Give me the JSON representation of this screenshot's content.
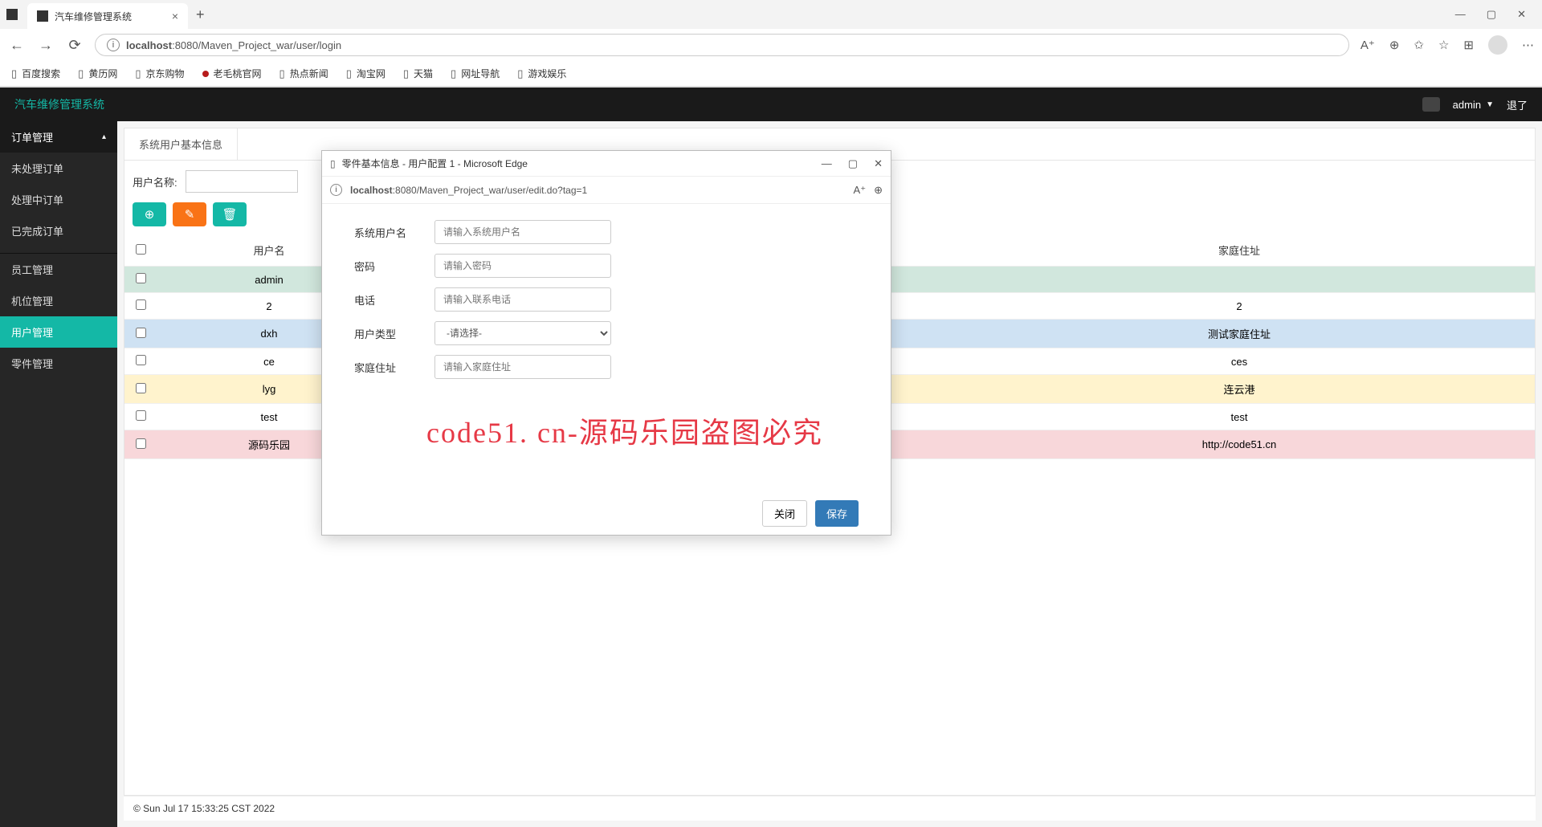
{
  "browser": {
    "tab_title": "汽车维修管理系统",
    "url_host": "localhost",
    "url_rest": ":8080/Maven_Project_war/user/login",
    "bookmarks": [
      "百度搜索",
      "黄历网",
      "京东购物",
      "老毛桃官网",
      "热点新闻",
      "淘宝网",
      "天猫",
      "网址导航",
      "游戏娱乐"
    ]
  },
  "app": {
    "brand": "汽车维修管理系统",
    "username": "admin",
    "logout": "退了"
  },
  "sidebar": {
    "group": "订单管理",
    "items": [
      "未处理订单",
      "处理中订单",
      "已完成订单",
      "员工管理",
      "机位管理",
      "用户管理",
      "零件管理"
    ],
    "active_index": 5
  },
  "panel": {
    "tab": "系统用户基本信息",
    "filter_label": "用户名称:",
    "columns": {
      "c0": "",
      "c1": "用户名",
      "c2": "家庭住址"
    },
    "rows": [
      {
        "cls": "r-green",
        "user": "admin",
        "addr": ""
      },
      {
        "cls": "",
        "user": "2",
        "addr": "2"
      },
      {
        "cls": "r-blue",
        "user": "dxh",
        "addr": "测试家庭住址"
      },
      {
        "cls": "",
        "user": "ce",
        "addr": "ces"
      },
      {
        "cls": "r-yellow",
        "user": "lyg",
        "addr": "连云港"
      },
      {
        "cls": "",
        "user": "test",
        "addr": "test"
      },
      {
        "cls": "r-red",
        "user": "源码乐园",
        "addr": "http://code51.cn"
      }
    ]
  },
  "popup": {
    "title": "零件基本信息 - 用户配置 1 - Microsoft Edge",
    "url_host": "localhost",
    "url_rest": ":8080/Maven_Project_war/user/edit.do?tag=1",
    "fields": {
      "user_label": "系统用户名",
      "user_ph": "请输入系统用户名",
      "pwd_label": "密码",
      "pwd_ph": "请输入密码",
      "tel_label": "电话",
      "tel_ph": "请输入联系电话",
      "type_label": "用户类型",
      "type_ph": "-请选择-",
      "addr_label": "家庭住址",
      "addr_ph": "请输入家庭住址"
    },
    "close": "关闭",
    "save": "保存"
  },
  "footer": "© Sun Jul 17 15:33:25 CST 2022",
  "watermark": "code51. cn-源码乐园盗图必究"
}
